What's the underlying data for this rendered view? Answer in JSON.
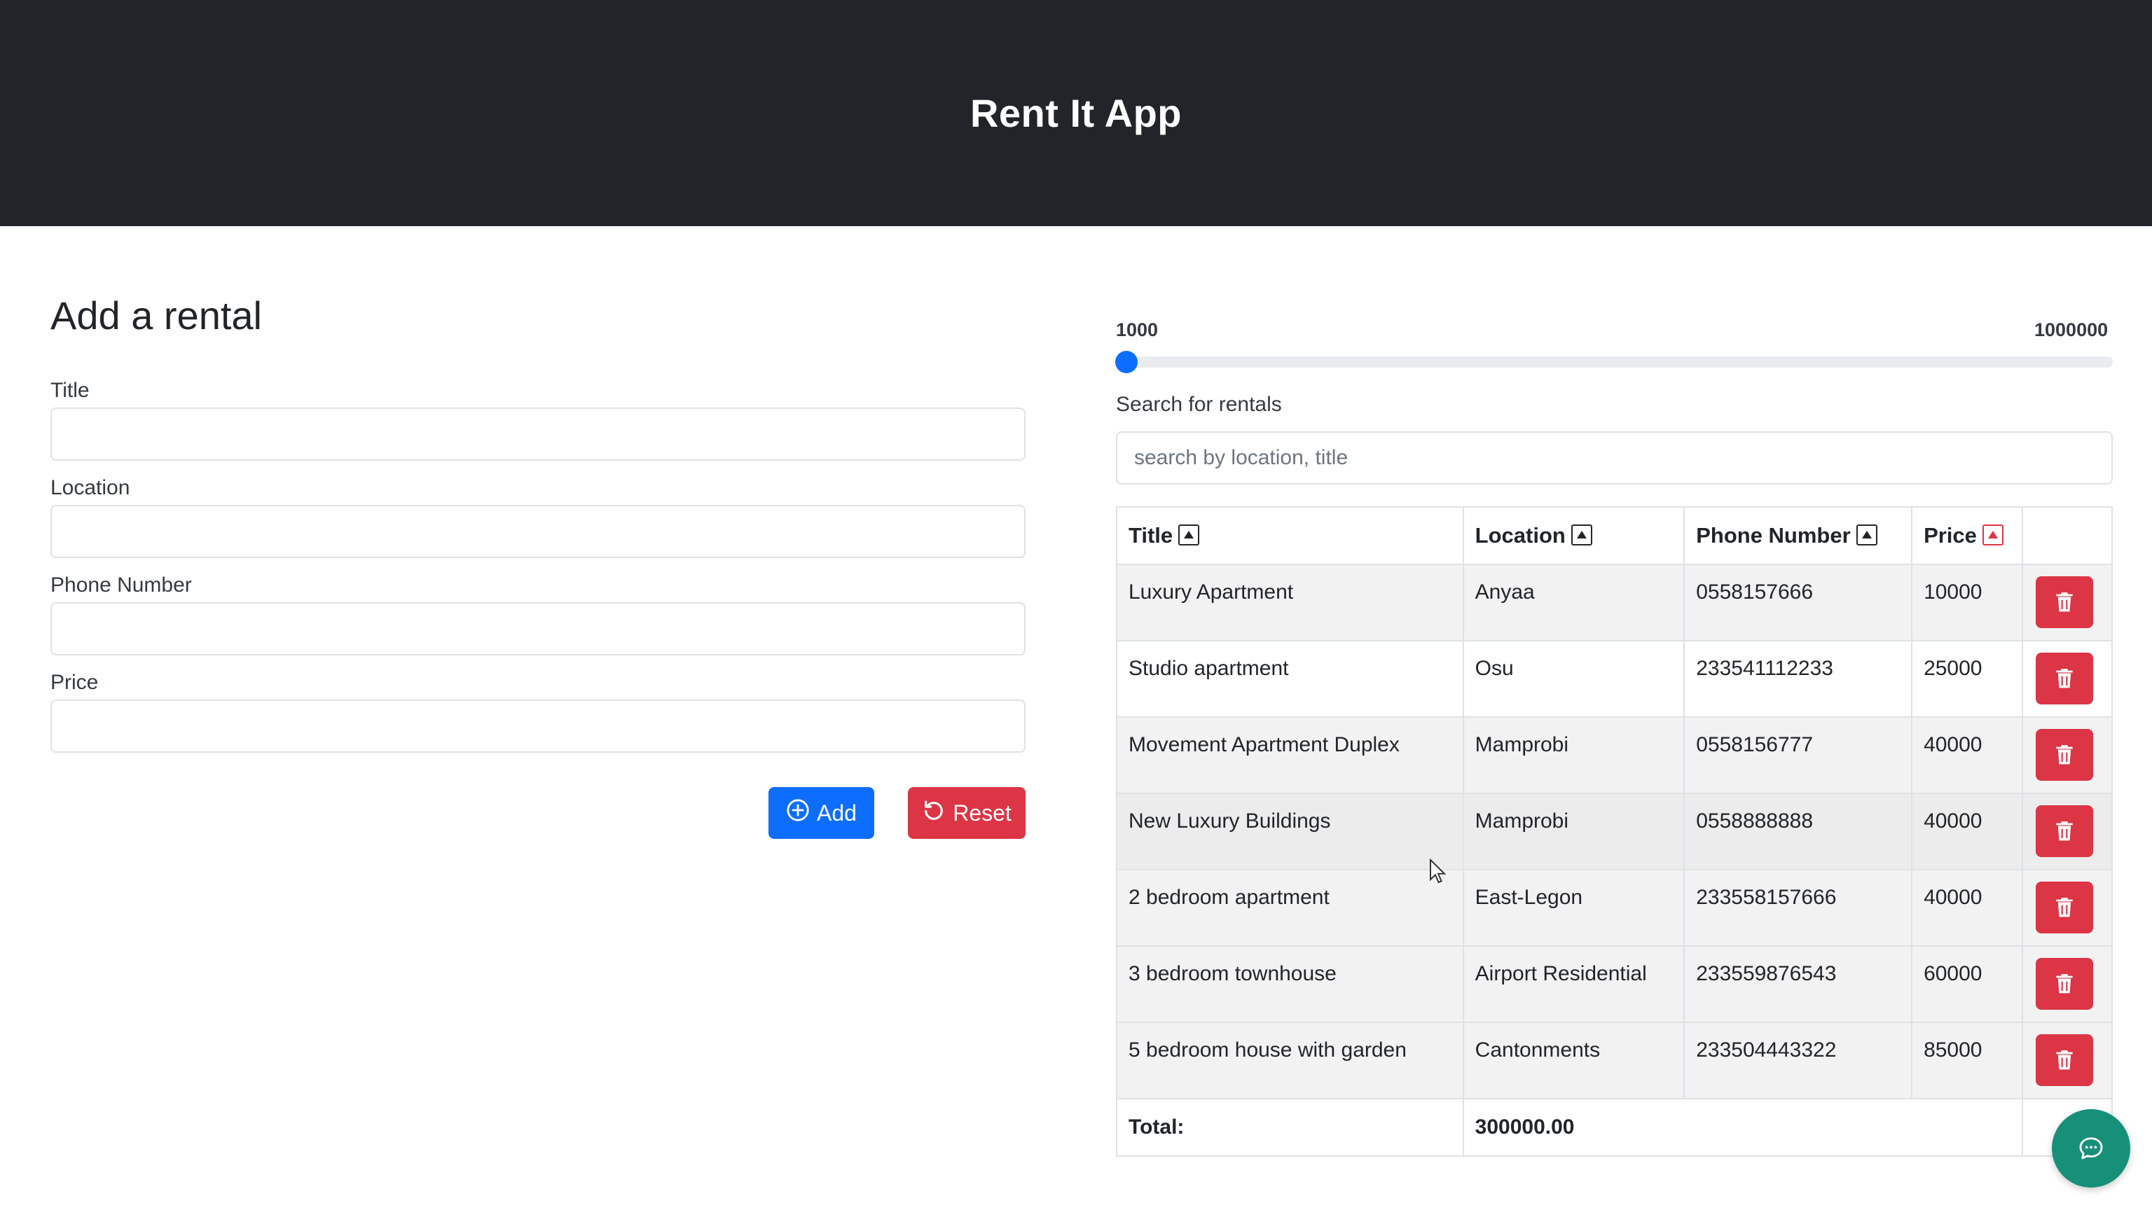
{
  "app": {
    "title": "Rent It App"
  },
  "form": {
    "heading": "Add a rental",
    "fields": [
      {
        "label": "Title",
        "value": "",
        "placeholder": ""
      },
      {
        "label": "Location",
        "value": "",
        "placeholder": ""
      },
      {
        "label": "Phone Number",
        "value": "",
        "placeholder": ""
      },
      {
        "label": "Price",
        "value": "",
        "placeholder": ""
      }
    ],
    "add_label": "Add",
    "reset_label": "Reset"
  },
  "filter": {
    "range_min": "1000",
    "range_max": "1000000",
    "range_value": 1000,
    "search_label": "Search for rentals",
    "search_placeholder": "search by location, title",
    "search_value": ""
  },
  "table": {
    "columns": [
      "Title",
      "Location",
      "Phone Number",
      "Price"
    ],
    "rows": [
      {
        "title": "Luxury Apartment",
        "location": "Anyaa",
        "phone": "0558157666",
        "price": "10000"
      },
      {
        "title": "Studio apartment",
        "location": "Osu",
        "phone": "233541112233",
        "price": "25000"
      },
      {
        "title": "Movement Apartment Duplex",
        "location": "Mamprobi",
        "phone": "0558156777",
        "price": "40000"
      },
      {
        "title": "New Luxury Buildings",
        "location": "Mamprobi",
        "phone": "0558888888",
        "price": "40000"
      },
      {
        "title": "2 bedroom apartment",
        "location": "East-Legon",
        "phone": "233558157666",
        "price": "40000"
      },
      {
        "title": "3 bedroom townhouse",
        "location": "Airport Residential",
        "phone": "233559876543",
        "price": "60000"
      },
      {
        "title": "5 bedroom house with garden",
        "location": "Cantonments",
        "phone": "233504443322",
        "price": "85000"
      }
    ],
    "total_label": "Total:",
    "total_value": "300000.00"
  },
  "colors": {
    "header_bg": "#212529",
    "primary": "#0d6efd",
    "danger": "#dc3545",
    "chat_fab": "#17907a"
  },
  "icons": {
    "add": "plus-circle-icon",
    "reset": "reset-icon",
    "delete": "trash-icon",
    "sort": "sort-up-icon",
    "chat": "chat-icon"
  }
}
